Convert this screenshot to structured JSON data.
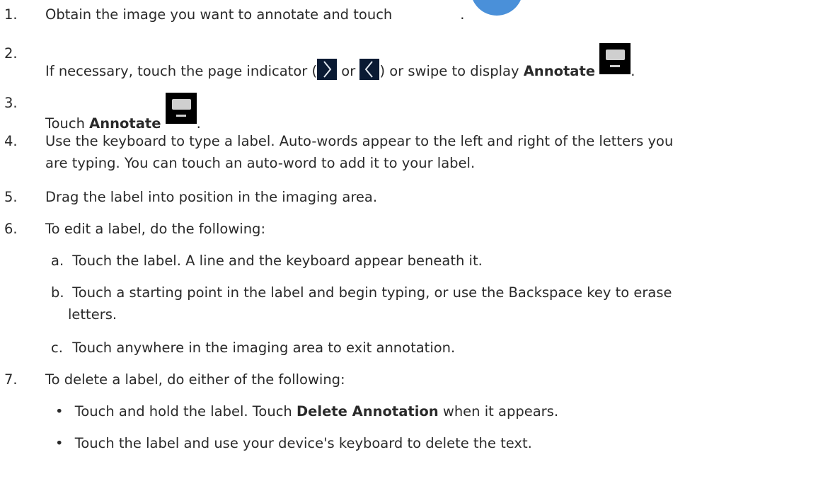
{
  "steps": [
    {
      "num": "1.",
      "text": "Obtain the image you want to annotate and touch",
      "after": "."
    },
    {
      "num": "2.",
      "pre": "If necessary, touch the page indicator (",
      "mid": "or",
      "post": ") or swipe to display",
      "bold": "Annotate",
      "after": "."
    },
    {
      "num": "3.",
      "pre": "Touch",
      "bold": "Annotate",
      "after": "."
    },
    {
      "num": "4.",
      "line1": "Use the keyboard to type a label. Auto-words appear to the left and right of the letters you",
      "line2": "are typing. You can touch an auto-word to add it to your label."
    },
    {
      "num": "5.",
      "text": "Drag the label into position in the imaging area."
    },
    {
      "num": "6.",
      "text": "To edit a label, do the following:"
    },
    {
      "num": "7.",
      "text": "To delete a label, do either of the following:"
    }
  ],
  "substeps": [
    {
      "letter": "a.",
      "text": "Touch the label. A line and the keyboard appear beneath it."
    },
    {
      "letter": "b.",
      "line1": "Touch a starting point in the label and begin typing, or use the Backspace key to erase",
      "line2": "letters."
    },
    {
      "letter": "c.",
      "text": "Touch anywhere in the imaging area to exit annotation."
    }
  ],
  "bullets": [
    {
      "pre": "Touch and hold the label. Touch",
      "bold": "Delete Annotation",
      "post": "when it appears."
    },
    {
      "pre": "Touch the label and use your device's keyboard to delete the text."
    }
  ],
  "icons": {
    "start_button": "blue-circle-button-icon",
    "page_next": "chevron-right-icon",
    "page_prev": "chevron-left-icon",
    "annotate": "keyboard-icon"
  },
  "colors": {
    "text": "#2a2a2a",
    "accent_blue": "#4a90d9"
  }
}
